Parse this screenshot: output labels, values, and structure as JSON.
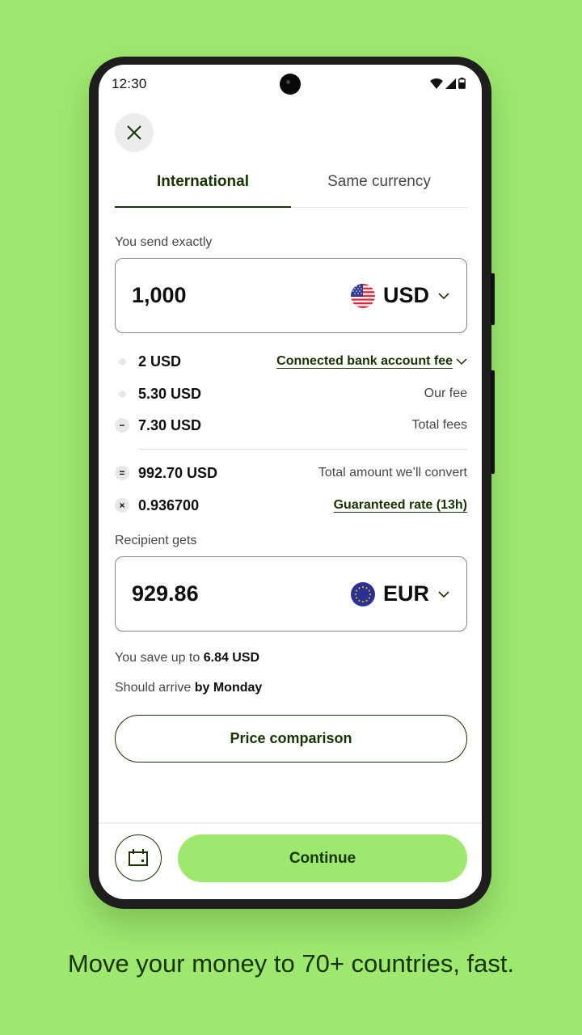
{
  "status_bar": {
    "time": "12:30",
    "icons": [
      "wifi-icon",
      "signal-icon",
      "battery-icon"
    ]
  },
  "header": {
    "close_icon": "close-icon"
  },
  "tabs": [
    {
      "label": "International",
      "active": true
    },
    {
      "label": "Same currency",
      "active": false
    }
  ],
  "send": {
    "label": "You send exactly",
    "amount": "1,000",
    "currency": "USD",
    "flag": "us-flag"
  },
  "fees": [
    {
      "bullet": "dot",
      "amount": "2 USD",
      "label": "Connected bank account fee",
      "is_link": true,
      "has_chevron": true
    },
    {
      "bullet": "dot",
      "amount": "5.30 USD",
      "label": "Our fee",
      "is_link": false
    },
    {
      "bullet": "−",
      "amount": "7.30 USD",
      "label": "Total fees",
      "is_link": false
    },
    {
      "bullet": "=",
      "amount": "992.70 USD",
      "label": "Total amount we’ll convert",
      "is_link": false
    },
    {
      "bullet": "×",
      "amount": "0.936700",
      "label": "Guaranteed rate (13h)",
      "is_link": true
    }
  ],
  "receive": {
    "label": "Recipient gets",
    "amount": "929.86",
    "currency": "EUR",
    "flag": "eu-flag"
  },
  "savings": {
    "prefix": "You save up to ",
    "value": "6.84 USD"
  },
  "arrival": {
    "prefix": "Should arrive ",
    "value": "by Monday"
  },
  "buttons": {
    "price_comparison": "Price comparison",
    "continue": "Continue",
    "schedule_icon": "calendar-icon"
  },
  "tagline": "Move your money to 70+ countries, fast.",
  "colors": {
    "brand_green": "#9fe870",
    "forest_green": "#163300"
  }
}
